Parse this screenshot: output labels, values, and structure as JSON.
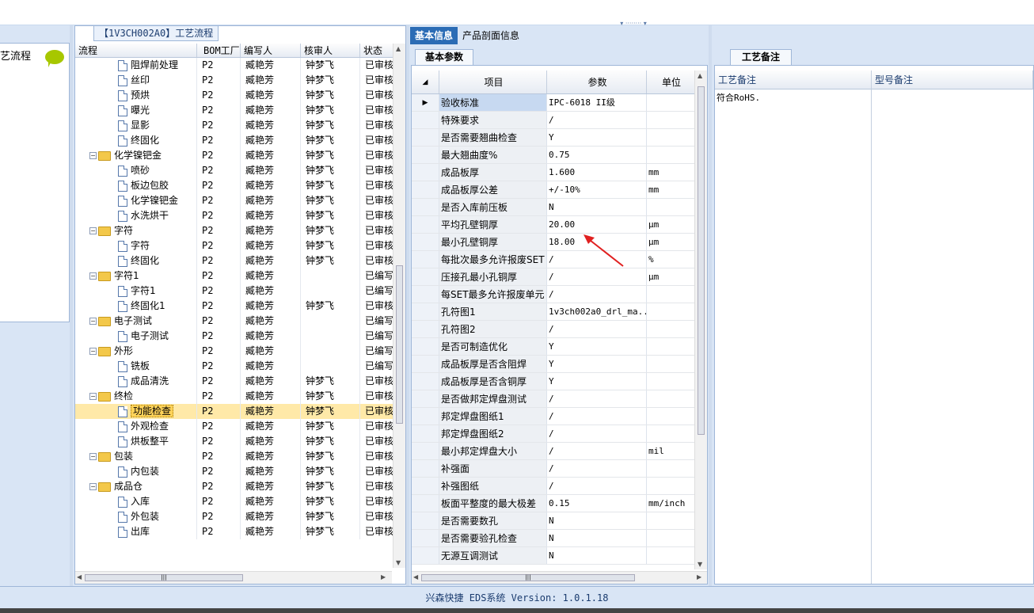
{
  "process_panel": {
    "title": "【1V3CH002A0】工艺流程",
    "left_nav_item": "艺流程",
    "columns": [
      "流程",
      "BOM工厂",
      "编写人",
      "核审人",
      "状态"
    ],
    "rows": [
      {
        "label": "阻焊前处理",
        "bom": "P2",
        "writer": "臧艳芳",
        "reviewer": "钟梦飞",
        "status": "已审核",
        "kind": "doc",
        "level": 2
      },
      {
        "label": "丝印",
        "bom": "P2",
        "writer": "臧艳芳",
        "reviewer": "钟梦飞",
        "status": "已审核",
        "kind": "doc",
        "level": 2
      },
      {
        "label": "预烘",
        "bom": "P2",
        "writer": "臧艳芳",
        "reviewer": "钟梦飞",
        "status": "已审核",
        "kind": "doc",
        "level": 2
      },
      {
        "label": "曝光",
        "bom": "P2",
        "writer": "臧艳芳",
        "reviewer": "钟梦飞",
        "status": "已审核",
        "kind": "doc",
        "level": 2
      },
      {
        "label": "显影",
        "bom": "P2",
        "writer": "臧艳芳",
        "reviewer": "钟梦飞",
        "status": "已审核",
        "kind": "doc",
        "level": 2
      },
      {
        "label": "终固化",
        "bom": "P2",
        "writer": "臧艳芳",
        "reviewer": "钟梦飞",
        "status": "已审核",
        "kind": "doc",
        "level": 2
      },
      {
        "label": "化学镍钯金",
        "bom": "P2",
        "writer": "臧艳芳",
        "reviewer": "钟梦飞",
        "status": "已审核",
        "kind": "folder",
        "level": 1
      },
      {
        "label": "喷砂",
        "bom": "P2",
        "writer": "臧艳芳",
        "reviewer": "钟梦飞",
        "status": "已审核",
        "kind": "doc",
        "level": 2
      },
      {
        "label": "板边包胶",
        "bom": "P2",
        "writer": "臧艳芳",
        "reviewer": "钟梦飞",
        "status": "已审核",
        "kind": "doc",
        "level": 2
      },
      {
        "label": "化学镍钯金",
        "bom": "P2",
        "writer": "臧艳芳",
        "reviewer": "钟梦飞",
        "status": "已审核",
        "kind": "doc",
        "level": 2
      },
      {
        "label": "水洗烘干",
        "bom": "P2",
        "writer": "臧艳芳",
        "reviewer": "钟梦飞",
        "status": "已审核",
        "kind": "doc",
        "level": 2
      },
      {
        "label": "字符",
        "bom": "P2",
        "writer": "臧艳芳",
        "reviewer": "钟梦飞",
        "status": "已审核",
        "kind": "folder",
        "level": 1
      },
      {
        "label": "字符",
        "bom": "P2",
        "writer": "臧艳芳",
        "reviewer": "钟梦飞",
        "status": "已审核",
        "kind": "doc",
        "level": 2
      },
      {
        "label": "终固化",
        "bom": "P2",
        "writer": "臧艳芳",
        "reviewer": "钟梦飞",
        "status": "已审核",
        "kind": "doc",
        "level": 2
      },
      {
        "label": "字符1",
        "bom": "P2",
        "writer": "臧艳芳",
        "reviewer": "",
        "status": "已编写",
        "kind": "folder",
        "level": 1
      },
      {
        "label": "字符1",
        "bom": "P2",
        "writer": "臧艳芳",
        "reviewer": "",
        "status": "已编写",
        "kind": "doc",
        "level": 2
      },
      {
        "label": "终固化1",
        "bom": "P2",
        "writer": "臧艳芳",
        "reviewer": "钟梦飞",
        "status": "已审核",
        "kind": "doc",
        "level": 2
      },
      {
        "label": "电子测试",
        "bom": "P2",
        "writer": "臧艳芳",
        "reviewer": "",
        "status": "已编写",
        "kind": "folder",
        "level": 1
      },
      {
        "label": "电子测试",
        "bom": "P2",
        "writer": "臧艳芳",
        "reviewer": "",
        "status": "已编写",
        "kind": "doc",
        "level": 2
      },
      {
        "label": "外形",
        "bom": "P2",
        "writer": "臧艳芳",
        "reviewer": "",
        "status": "已编写",
        "kind": "folder",
        "level": 1
      },
      {
        "label": "铣板",
        "bom": "P2",
        "writer": "臧艳芳",
        "reviewer": "",
        "status": "已编写",
        "kind": "doc",
        "level": 2
      },
      {
        "label": "成品清洗",
        "bom": "P2",
        "writer": "臧艳芳",
        "reviewer": "钟梦飞",
        "status": "已审核",
        "kind": "doc",
        "level": 2
      },
      {
        "label": "终检",
        "bom": "P2",
        "writer": "臧艳芳",
        "reviewer": "钟梦飞",
        "status": "已审核",
        "kind": "folder",
        "level": 1
      },
      {
        "label": "功能检查",
        "bom": "P2",
        "writer": "臧艳芳",
        "reviewer": "钟梦飞",
        "status": "已审核",
        "kind": "doc",
        "level": 2,
        "selected": true
      },
      {
        "label": "外观检查",
        "bom": "P2",
        "writer": "臧艳芳",
        "reviewer": "钟梦飞",
        "status": "已审核",
        "kind": "doc",
        "level": 2
      },
      {
        "label": "烘板整平",
        "bom": "P2",
        "writer": "臧艳芳",
        "reviewer": "钟梦飞",
        "status": "已审核",
        "kind": "doc",
        "level": 2
      },
      {
        "label": "包装",
        "bom": "P2",
        "writer": "臧艳芳",
        "reviewer": "钟梦飞",
        "status": "已审核",
        "kind": "folder",
        "level": 1
      },
      {
        "label": "内包装",
        "bom": "P2",
        "writer": "臧艳芳",
        "reviewer": "钟梦飞",
        "status": "已审核",
        "kind": "doc",
        "level": 2
      },
      {
        "label": "成品仓",
        "bom": "P2",
        "writer": "臧艳芳",
        "reviewer": "钟梦飞",
        "status": "已审核",
        "kind": "folder",
        "level": 1
      },
      {
        "label": "入库",
        "bom": "P2",
        "writer": "臧艳芳",
        "reviewer": "钟梦飞",
        "status": "已审核",
        "kind": "doc",
        "level": 2
      },
      {
        "label": "外包装",
        "bom": "P2",
        "writer": "臧艳芳",
        "reviewer": "钟梦飞",
        "status": "已审核",
        "kind": "doc",
        "level": 2
      },
      {
        "label": "出库",
        "bom": "P2",
        "writer": "臧艳芳",
        "reviewer": "钟梦飞",
        "status": "已审核",
        "kind": "doc",
        "level": 2
      }
    ]
  },
  "middle_panel": {
    "tabs": [
      "基本信息",
      "产品剖面信息"
    ],
    "subtab": "基本参数",
    "columns": [
      "项目",
      "参数",
      "单位"
    ],
    "rows": [
      {
        "item": "验收标准",
        "param": "IPC-6018 II级",
        "unit": "",
        "current": true
      },
      {
        "item": "特殊要求",
        "param": "/",
        "unit": ""
      },
      {
        "item": "是否需要翘曲检查",
        "param": "Y",
        "unit": ""
      },
      {
        "item": "最大翘曲度%",
        "param": "0.75",
        "unit": ""
      },
      {
        "item": "成品板厚",
        "param": "1.600",
        "unit": "mm"
      },
      {
        "item": "成品板厚公差",
        "param": "+/-10%",
        "unit": "mm"
      },
      {
        "item": "是否入库前压板",
        "param": "N",
        "unit": ""
      },
      {
        "item": "平均孔壁铜厚",
        "param": "20.00",
        "unit": "μm"
      },
      {
        "item": "最小孔壁铜厚",
        "param": "18.00",
        "unit": "μm"
      },
      {
        "item": "每批次最多允许报废SET",
        "param": "/",
        "unit": "%"
      },
      {
        "item": "压接孔最小孔铜厚",
        "param": "/",
        "unit": "μm"
      },
      {
        "item": "每SET最多允许报废单元",
        "param": "/",
        "unit": ""
      },
      {
        "item": "孔符图1",
        "param": "1v3ch002a0_drl_ma...",
        "unit": ""
      },
      {
        "item": "孔符图2",
        "param": "/",
        "unit": ""
      },
      {
        "item": "是否可制造优化",
        "param": "Y",
        "unit": ""
      },
      {
        "item": "成品板厚是否含阻焊",
        "param": "Y",
        "unit": ""
      },
      {
        "item": "成品板厚是否含铜厚",
        "param": "Y",
        "unit": ""
      },
      {
        "item": "是否做邦定焊盘测试",
        "param": "/",
        "unit": ""
      },
      {
        "item": "邦定焊盘图纸1",
        "param": "/",
        "unit": ""
      },
      {
        "item": "邦定焊盘图纸2",
        "param": "/",
        "unit": ""
      },
      {
        "item": "最小邦定焊盘大小",
        "param": "/",
        "unit": "mil"
      },
      {
        "item": "补强面",
        "param": "/",
        "unit": ""
      },
      {
        "item": "补强图纸",
        "param": "/",
        "unit": ""
      },
      {
        "item": "板面平整度的最大极差",
        "param": "0.15",
        "unit": "mm/inch"
      },
      {
        "item": "是否需要数孔",
        "param": "N",
        "unit": ""
      },
      {
        "item": "是否需要验孔检查",
        "param": "N",
        "unit": ""
      },
      {
        "item": "无源互调测试",
        "param": "N",
        "unit": ""
      }
    ]
  },
  "right_panel": {
    "subtab": "工艺备注",
    "col1": "工艺备注",
    "col2": "型号备注",
    "memo": "符合RoHS."
  },
  "status_bar": {
    "text": "兴森快捷 EDS系统 Version: 1.0.1.18"
  },
  "colors": {
    "accent": "#2b6cb5",
    "selection": "#ffe9a8",
    "annotation_arrow": "#e02020"
  }
}
